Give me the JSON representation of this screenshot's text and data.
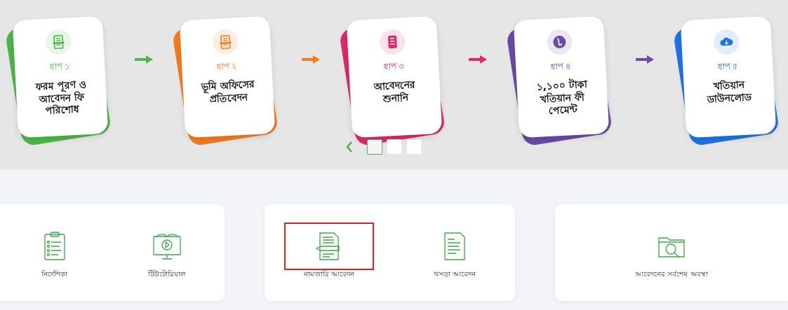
{
  "steps": [
    {
      "step": "ধাপ ১",
      "title": "ফরম পূরণ ও আবেদন ফি পরিশোধ",
      "color": "#4cb848",
      "kind": "form"
    },
    {
      "step": "ধাপ ২",
      "title": "ভূমি অফিসের প্রতিবেদন",
      "color": "#f57c1f",
      "kind": "report"
    },
    {
      "step": "ধাপ ৩",
      "title": "আবেদনের শুনানি",
      "color": "#e0286a",
      "kind": "list"
    },
    {
      "step": "ধাপ ৪",
      "title": "১,১০০ টাকা খতিয়ান ফী পেমেন্ট",
      "color": "#6a4aa8",
      "kind": "taka"
    },
    {
      "step": "ধাপ ৫",
      "title": "খতিয়ান ডাউনলোড",
      "color": "#1f73e8",
      "kind": "cloud"
    }
  ],
  "thumbnails": [
    {
      "selected": true
    },
    {
      "selected": false
    },
    {
      "selected": false
    }
  ],
  "groups": [
    {
      "items": [
        {
          "label": "নির্দেশিকা",
          "kind": "checklist",
          "highlighted": false
        },
        {
          "label": "টিউটোরিয়াল",
          "kind": "tutorial",
          "highlighted": false
        }
      ]
    },
    {
      "items": [
        {
          "label": "নামজারি আবেদন",
          "kind": "write",
          "highlighted": true
        },
        {
          "label": "খসড়া আবেদন",
          "kind": "draft",
          "highlighted": false
        }
      ]
    },
    {
      "items": [
        {
          "label": "আবেদনের সর্বশেষ অবস্থা",
          "kind": "search",
          "highlighted": false
        }
      ]
    }
  ]
}
